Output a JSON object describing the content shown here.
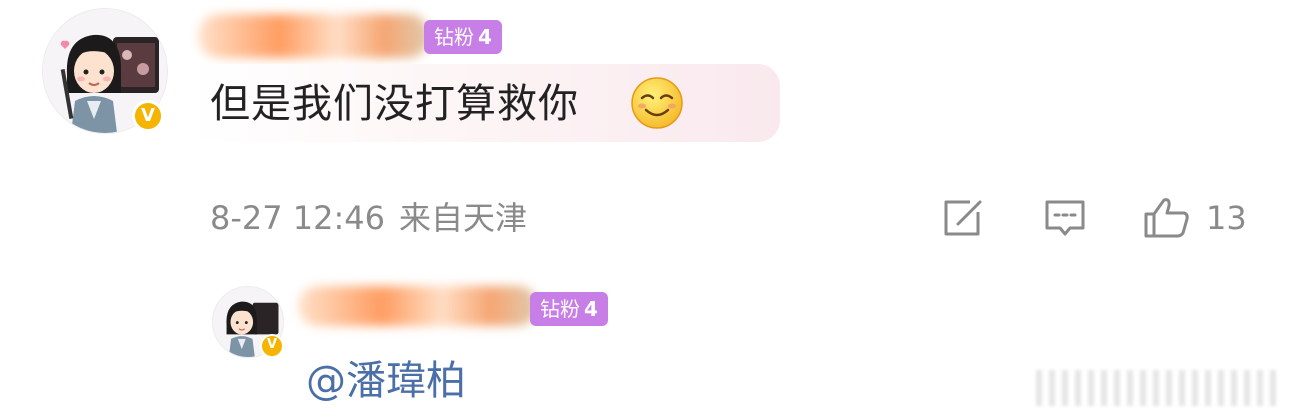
{
  "comment": {
    "fan_badge": {
      "label": "钻粉",
      "level": "4"
    },
    "verified_mark": "V",
    "text": "但是我们没打算救你",
    "emoji": "smile-emoji",
    "date": "8-27 12:46",
    "location": "来自天津",
    "like_count": "13",
    "icons": [
      "share-icon",
      "comment-icon",
      "like-icon"
    ]
  },
  "reply": {
    "fan_badge": {
      "label": "钻粉",
      "level": "4"
    },
    "verified_mark": "V",
    "text": "@潘瑋柏"
  },
  "colors": {
    "badge_purple": "#c77ee6",
    "verified_gold": "#f5b400",
    "mention_blue": "#4b6fa8",
    "meta_gray": "#8a8a8a"
  }
}
